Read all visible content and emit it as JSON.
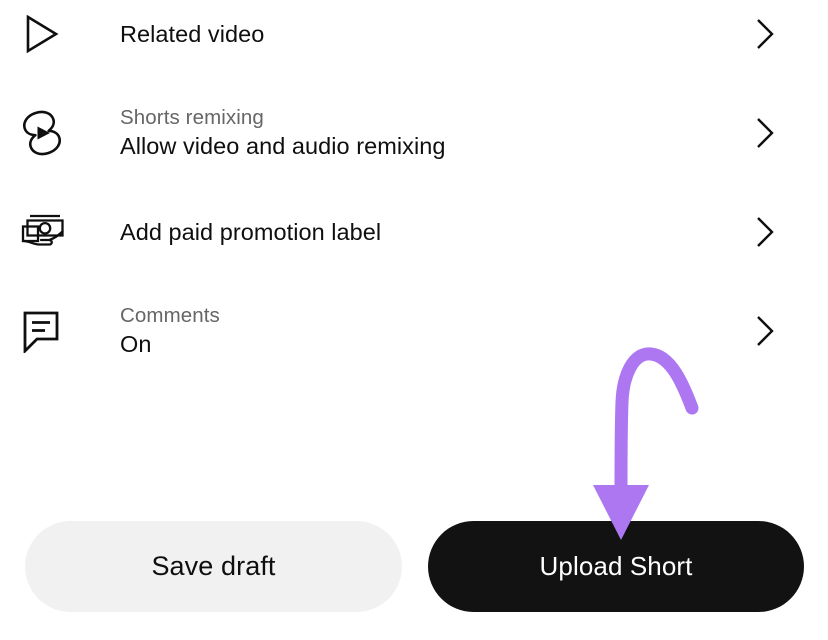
{
  "screen": {
    "name": "YouTube Shorts upload settings",
    "background_color": "#ffffff"
  },
  "settings_rows": [
    {
      "id": "related-video",
      "icon": "play-triangle-icon",
      "sub_label": "",
      "title": "Related video",
      "chevron": "chevron-right-icon"
    },
    {
      "id": "shorts-remixing",
      "icon": "shorts-icon",
      "sub_label": "Shorts remixing",
      "title": "Allow video and audio remixing",
      "chevron": "chevron-right-icon"
    },
    {
      "id": "paid-promotion",
      "icon": "paid-promotion-icon",
      "sub_label": "",
      "title": "Add paid promotion label",
      "chevron": "chevron-right-icon"
    },
    {
      "id": "comments",
      "icon": "comment-bubble-icon",
      "sub_label": "Comments",
      "title": "On",
      "chevron": "chevron-right-icon"
    }
  ],
  "footer": {
    "save_draft_label": "Save draft",
    "upload_short_label": "Upload Short",
    "save_draft_bg": "#f1f1f1",
    "upload_short_bg": "#121212"
  },
  "annotation": {
    "type": "curved-down-arrow",
    "color": "#ae77f2",
    "points_at": "Upload Short"
  },
  "colors": {
    "primary_text": "#0f0f0f",
    "secondary_text": "#666666",
    "accent_purple": "#ae77f2"
  }
}
